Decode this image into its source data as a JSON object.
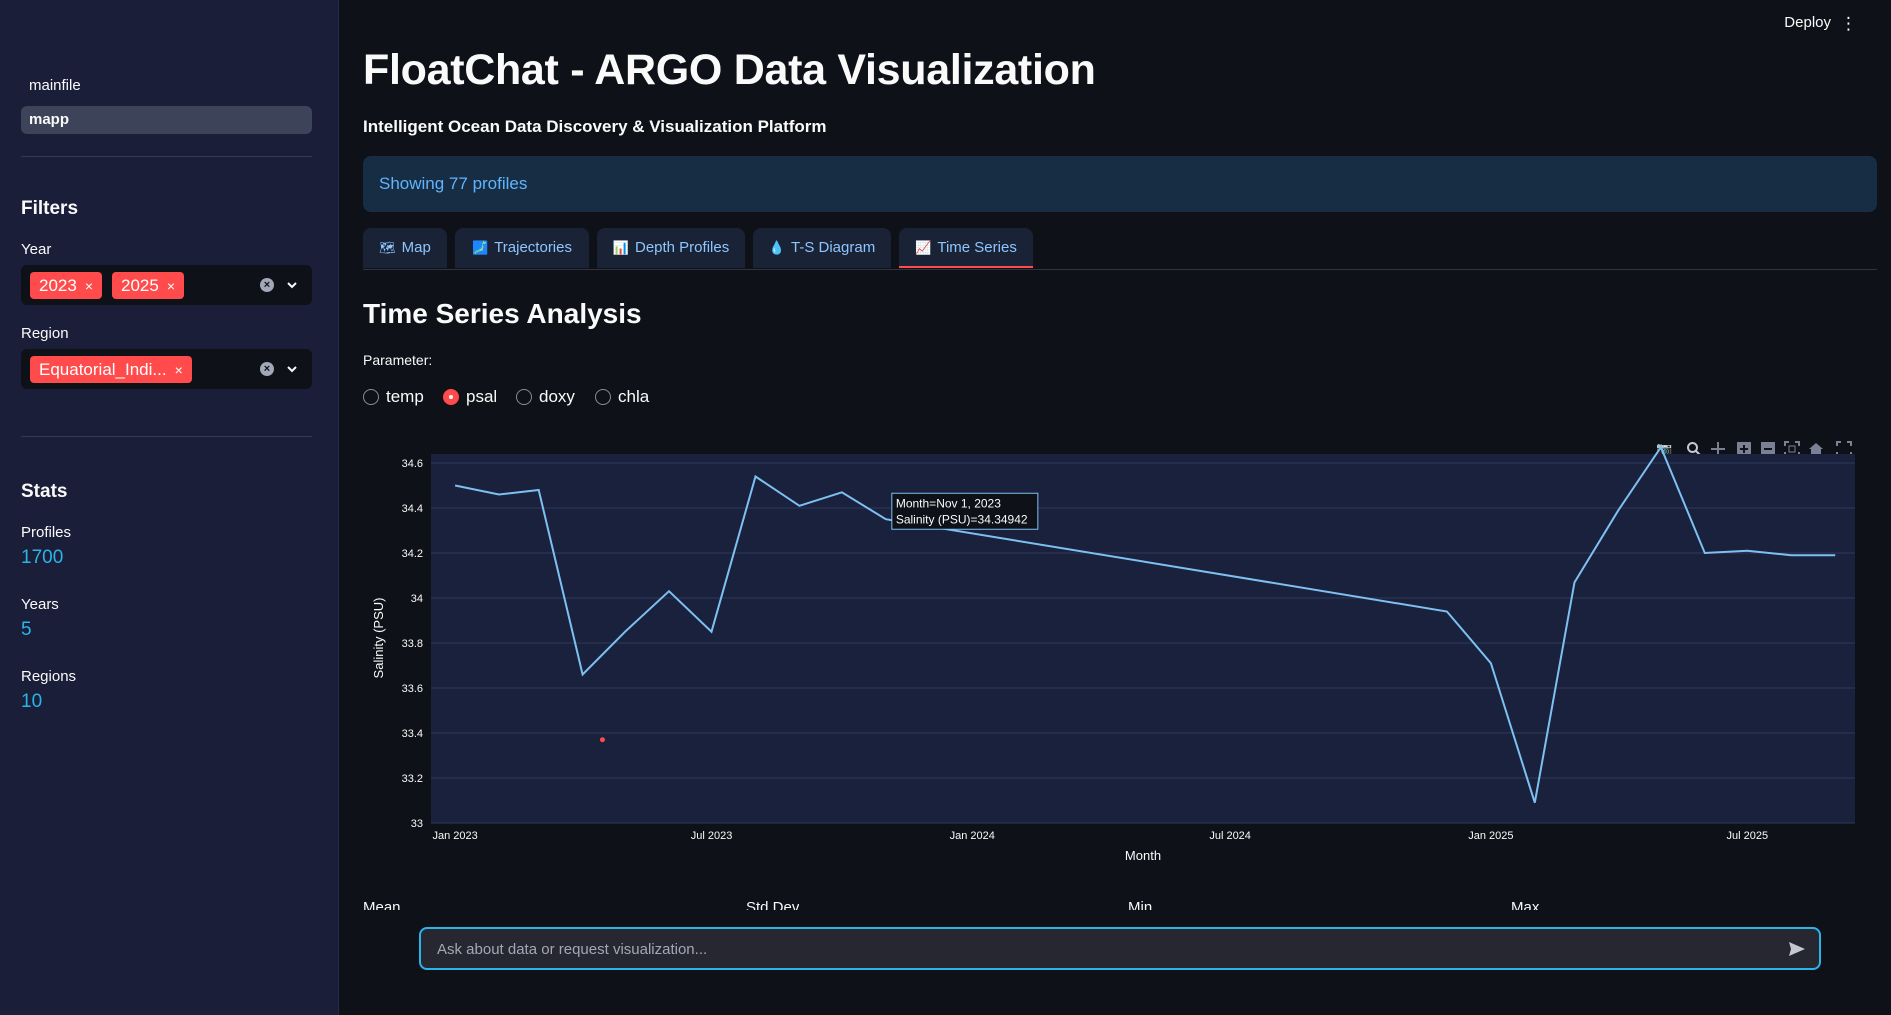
{
  "sidebar": {
    "nav": [
      {
        "label": "mainfile",
        "active": false
      },
      {
        "label": "mapp",
        "active": true
      }
    ],
    "filters_heading": "Filters",
    "year": {
      "label": "Year",
      "tags": [
        "2023",
        "2025"
      ],
      "remove_glyph": "×"
    },
    "region": {
      "label": "Region",
      "tags": [
        "Equatorial_Indi..."
      ],
      "remove_glyph": "×"
    },
    "stats_heading": "Stats",
    "stats": [
      {
        "label": "Profiles",
        "value": "1700"
      },
      {
        "label": "Years",
        "value": "5"
      },
      {
        "label": "Regions",
        "value": "10"
      }
    ]
  },
  "header": {
    "deploy_label": "Deploy",
    "menu_glyph": "⋮"
  },
  "main": {
    "title": "FloatChat - ARGO Data Visualization",
    "subtitle": "Intelligent Ocean Data Discovery & Visualization Platform",
    "info": "Showing 77 profiles",
    "tabs": [
      {
        "label": "Map",
        "icon": "map-icon",
        "glyph": "🗺",
        "active": false
      },
      {
        "label": "Trajectories",
        "icon": "trajectory-icon",
        "glyph": "🗾",
        "active": false
      },
      {
        "label": "Depth Profiles",
        "icon": "bar-chart-icon",
        "glyph": "📊",
        "active": false
      },
      {
        "label": "T-S Diagram",
        "icon": "droplet-icon",
        "glyph": "💧",
        "active": false
      },
      {
        "label": "Time Series",
        "icon": "line-chart-icon",
        "glyph": "📈",
        "active": true
      }
    ],
    "section_title": "Time Series Analysis",
    "parameter_label": "Parameter:",
    "parameters": [
      {
        "label": "temp",
        "selected": false
      },
      {
        "label": "psal",
        "selected": true
      },
      {
        "label": "doxy",
        "selected": false
      },
      {
        "label": "chla",
        "selected": false
      }
    ],
    "summary_labels": [
      "Mean",
      "Std Dev",
      "Min",
      "Max"
    ],
    "chat_placeholder": "Ask about data or request visualization..."
  },
  "colors": {
    "accent": "#ff4b4b",
    "line": "#7ec0f2",
    "plot_bg": "#19213d",
    "info_text": "#60b4ff",
    "stat_value": "#29b5e8"
  },
  "chart_data": {
    "type": "line",
    "xlabel": "Month",
    "ylabel": "Salinity (PSU)",
    "ylim": [
      33,
      34.64
    ],
    "yticks": [
      33,
      33.2,
      33.4,
      33.6,
      33.8,
      34,
      34.2,
      34.4,
      34.6
    ],
    "ytick_labels": [
      "33",
      "33.2",
      "33.4",
      "33.6",
      "33.8",
      "34",
      "34.2",
      "34.4",
      "34.6"
    ],
    "xlim": [
      "2022-12-15",
      "2025-09-15"
    ],
    "xticks": [
      "2023-01-01",
      "2023-07-01",
      "2024-01-01",
      "2024-07-01",
      "2025-01-01",
      "2025-07-01"
    ],
    "xtick_labels": [
      "Jan 2023",
      "Jul 2023",
      "Jan 2024",
      "Jul 2024",
      "Jan 2025",
      "Jul 2025"
    ],
    "grid": true,
    "series": [
      {
        "x": [
          "2023-01-01",
          "2023-02-01",
          "2023-03-01",
          "2023-04-01",
          "2023-05-01",
          "2023-06-01",
          "2023-07-01",
          "2023-08-01",
          "2023-09-01",
          "2023-10-01",
          "2023-11-01",
          "2024-12-01",
          "2025-01-01",
          "2025-02-01",
          "2025-03-01",
          "2025-04-01",
          "2025-05-01",
          "2025-06-01",
          "2025-07-01",
          "2025-08-01",
          "2025-09-01"
        ],
        "y": [
          34.5,
          34.46,
          34.48,
          33.66,
          33.85,
          34.03,
          33.85,
          34.54,
          34.41,
          34.47,
          34.35,
          33.94,
          33.71,
          33.09,
          34.07,
          34.39,
          34.67,
          34.2,
          34.21,
          34.19,
          34.19
        ]
      }
    ],
    "marker": {
      "x": "2023-04-15",
      "y": 33.37
    },
    "tooltip": {
      "line1": "Month=Nov 1, 2023",
      "line2": "Salinity (PSU)=34.34942",
      "anchor_x": "2023-11-01",
      "anchor_y": 34.35
    }
  }
}
